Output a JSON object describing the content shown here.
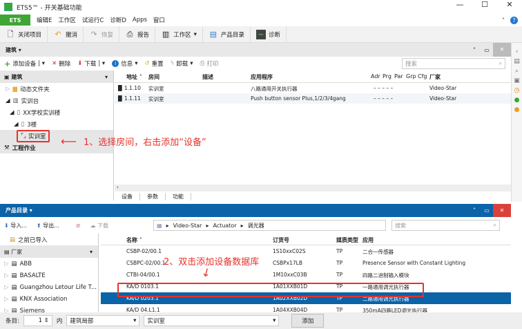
{
  "window": {
    "title": "ETS5™ - 开关基础功能"
  },
  "menu": {
    "ets": "ETS",
    "items": [
      "编辑E",
      "工作区",
      "试运行C",
      "诊断D",
      "Apps",
      "窗口"
    ]
  },
  "toolbar": [
    "关闭项目",
    "撤消",
    "恢复",
    "报告",
    "工作区",
    "产品目录",
    "诊断"
  ],
  "building": {
    "title": "建筑 ▾",
    "tools": [
      "添加设备",
      "删除",
      "下载",
      "信息",
      "重置",
      "卸载",
      "打印"
    ],
    "search_placeholder": "搜索",
    "tree_header": "建筑",
    "tree": [
      "动态文件夹",
      "实训台",
      "XX学校实训楼",
      "3楼",
      "实训室"
    ],
    "work": "工程作业",
    "columns": [
      "地址 ˄",
      "房间",
      "描述",
      "应用程序",
      "Adr",
      "Prg",
      "Par",
      "Grp",
      "Cfg",
      "厂家"
    ],
    "rows": [
      {
        "addr": "1.1.10",
        "room": "实训室",
        "app": "八路通用开关执行器",
        "flags": "–   –   –   –   –",
        "vendor": "Video-Star"
      },
      {
        "addr": "1.1.11",
        "room": "实训室",
        "app": "Push button sensor Plus,1/2/3/4gang",
        "flags": "–   –   –   –   –",
        "vendor": "Video-Star"
      }
    ],
    "tabs": [
      "设备",
      "参数",
      "功能"
    ]
  },
  "annotations": {
    "a1": "1、选择房间，右击添加“设备”",
    "a2": "2、双击添加设备数据库"
  },
  "catalog": {
    "title": "产品目录 ▾",
    "tools": [
      "导入...",
      "导出...",
      "下载"
    ],
    "breadcrumb": [
      "Video-Star",
      "Actuator",
      "调光器"
    ],
    "search_placeholder": "搜索",
    "prev": "之前已导入",
    "vendor_header": "厂家",
    "vendors": [
      "ABB",
      "BASALTE",
      "Guangzhou Letour Life T...",
      "KNX Association",
      "Siemens"
    ],
    "columns": [
      "名称 ˄",
      "订货号",
      "媒质类型",
      "应用"
    ],
    "rows": [
      {
        "name": "CSBP-02/00.1",
        "order": "1S10xxC02S",
        "medium": "TP",
        "app": "二合一传感器"
      },
      {
        "name": "CSBPC-02/00.1",
        "order": "CSBPx17LB",
        "medium": "TP",
        "app": "Presence Sensor with Constant Lighting"
      },
      {
        "name": "CTBI-04/00.1",
        "order": "1M10xxC03B",
        "medium": "TP",
        "app": "四路二进制输入模块"
      },
      {
        "name": "KA/D 0103.1",
        "order": "1A01XXB01D",
        "medium": "TP",
        "app": "一路通用调光执行器"
      },
      {
        "name": "KA/D 0203.1",
        "order": "1A02XXB02D",
        "medium": "TP",
        "app": "二路通用调光执行器"
      },
      {
        "name": "KA/D 04.L1.1",
        "order": "1A04XXB04D",
        "medium": "TP",
        "app": "350mA四路LED调光执行器"
      }
    ]
  },
  "bottom": {
    "label": "条目:",
    "count": "1",
    "in": "内",
    "scope": "建筑局部",
    "room": "实训室",
    "add": "添加"
  }
}
